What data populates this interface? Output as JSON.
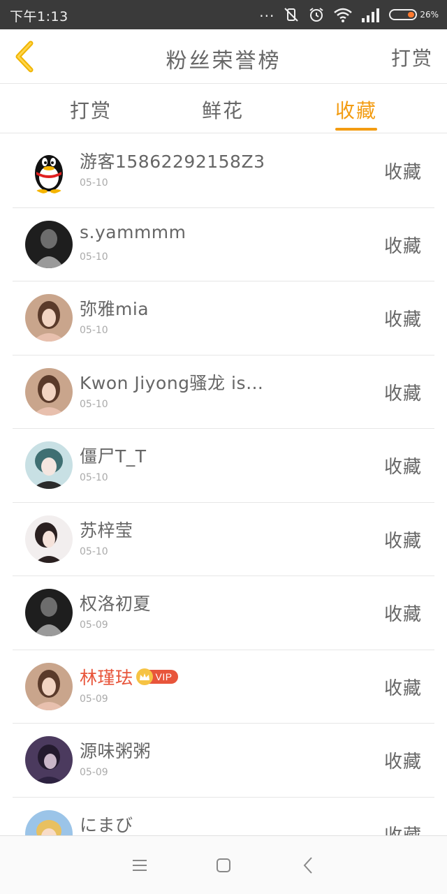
{
  "status_bar": {
    "time": "下午1:13",
    "dots": "...",
    "battery_text": "26%",
    "battery_color": "#ff7a2f"
  },
  "header": {
    "back_icon": "chevron-left-icon",
    "back_color": "#f0b400",
    "title": "粉丝荣誉榜",
    "action": "打赏"
  },
  "tabs": [
    {
      "label": "打赏",
      "active": false
    },
    {
      "label": "鲜花",
      "active": false
    },
    {
      "label": "收藏",
      "active": true
    }
  ],
  "accent_color": "#f39c12",
  "rows": [
    {
      "name": "游客15862292158Z3",
      "date": "05-10",
      "action": "收藏",
      "vip": false,
      "avatar": "qq-penguin"
    },
    {
      "name": "s.yammmm",
      "date": "05-10",
      "action": "收藏",
      "vip": false,
      "avatar": "photo-dark"
    },
    {
      "name": "弥雅mia",
      "date": "05-10",
      "action": "收藏",
      "vip": false,
      "avatar": "photo-girl"
    },
    {
      "name": "Kwon Jiyong骚龙 is…",
      "date": "05-10",
      "action": "收藏",
      "vip": false,
      "avatar": "photo-girl"
    },
    {
      "name": "僵尸T_T",
      "date": "05-10",
      "action": "收藏",
      "vip": false,
      "avatar": "photo-anime"
    },
    {
      "name": "苏梓莹",
      "date": "05-10",
      "action": "收藏",
      "vip": false,
      "avatar": "photo-light"
    },
    {
      "name": "权洛初夏",
      "date": "05-09",
      "action": "收藏",
      "vip": false,
      "avatar": "photo-dark"
    },
    {
      "name": "林瑾珐",
      "date": "05-09",
      "action": "收藏",
      "vip": true,
      "vip_label": "VIP",
      "avatar": "photo-girl"
    },
    {
      "name": "源味粥粥",
      "date": "05-09",
      "action": "收藏",
      "vip": false,
      "avatar": "photo-purple"
    },
    {
      "name": "にまび",
      "date": "",
      "action": "收藏",
      "vip": false,
      "avatar": "photo-cartoon"
    }
  ],
  "nav_icons": [
    "menu-icon",
    "home-square-icon",
    "back-arrow-icon"
  ]
}
